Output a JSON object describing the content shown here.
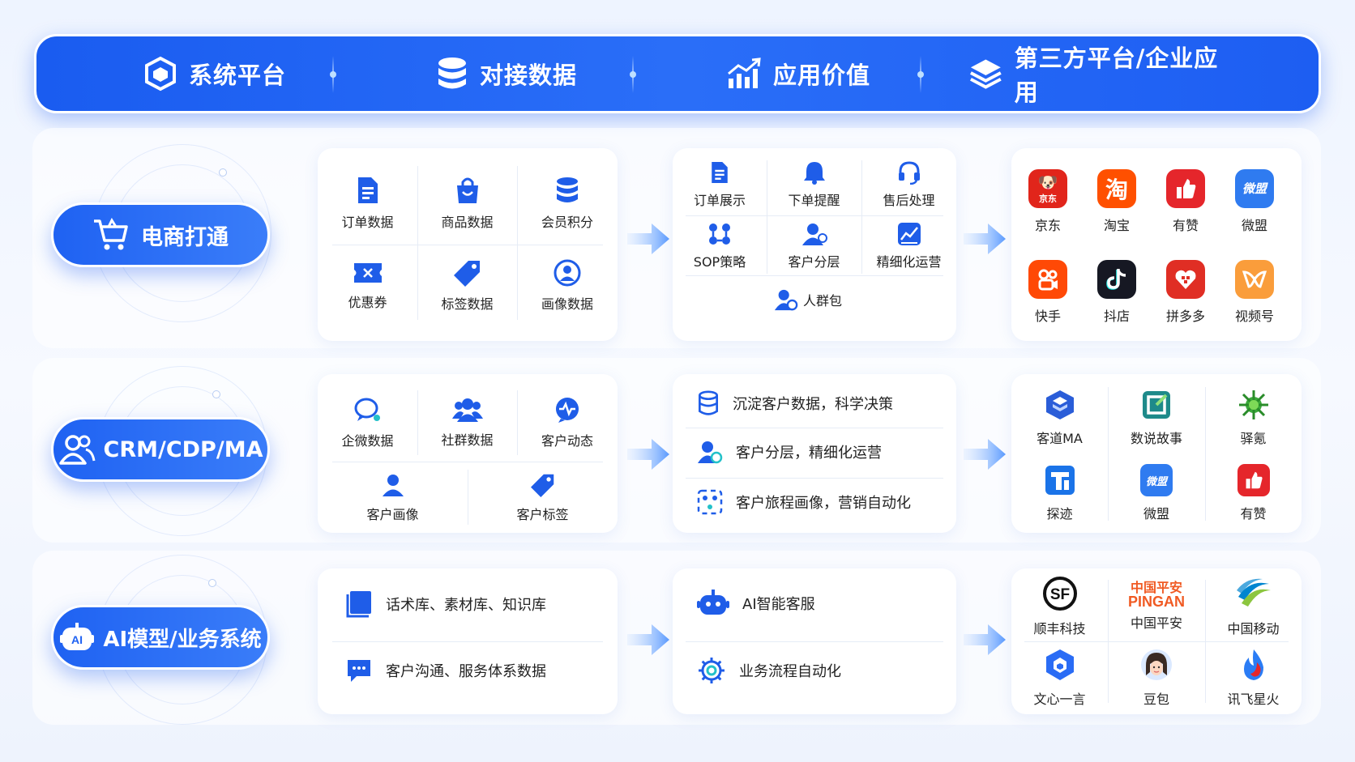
{
  "header": {
    "columns": [
      "系统平台",
      "对接数据",
      "应用价值",
      "第三方平台/企业应用"
    ]
  },
  "rows": [
    {
      "title": "电商打通",
      "data_items": [
        "订单数据",
        "商品数据",
        "会员积分",
        "优惠券",
        "标签数据",
        "画像数据"
      ],
      "value_items": [
        "订单展示",
        "下单提醒",
        "售后处理",
        "SOP策略",
        "客户分层",
        "精细化运营",
        "人群包"
      ],
      "apps": [
        "京东",
        "淘宝",
        "有赞",
        "微盟",
        "快手",
        "抖店",
        "拼多多",
        "视频号"
      ]
    },
    {
      "title": "CRM/CDP/MA",
      "data_items": [
        "企微数据",
        "社群数据",
        "客户动态",
        "客户画像",
        "客户标签"
      ],
      "value_items": [
        "沉淀客户数据，科学决策",
        "客户分层，精细化运营",
        "客户旅程画像，营销自动化"
      ],
      "apps": [
        "客道MA",
        "数说故事",
        "驿氪",
        "探迹",
        "微盟",
        "有赞"
      ]
    },
    {
      "title": "AI模型/业务系统",
      "data_items": [
        "话术库、素材库、知识库",
        "客户沟通、服务体系数据"
      ],
      "value_items": [
        "AI智能客服",
        "业务流程自动化"
      ],
      "apps": [
        "顺丰科技",
        "中国平安",
        "中国移动",
        "文心一言",
        "豆包",
        "讯飞星火"
      ]
    }
  ],
  "logo_text": {
    "jd": "京东",
    "taobao": "淘",
    "weimeng": "微盟",
    "pingan_cn": "中国平安",
    "pingan_en": "PINGAN",
    "sf": "SF"
  },
  "colors": {
    "primary": "#1f62f2",
    "icon_blue": "#1f5de8",
    "jd_red": "#e1251b",
    "taobao_orange": "#ff5000",
    "youzan_red": "#e5262b",
    "weimeng_blue": "#2f7bf0",
    "kuaishou_orange": "#ff4906",
    "douyin_black": "#161823",
    "pdd_red": "#e02e24",
    "shipinhao_orange": "#fa9d3b"
  }
}
